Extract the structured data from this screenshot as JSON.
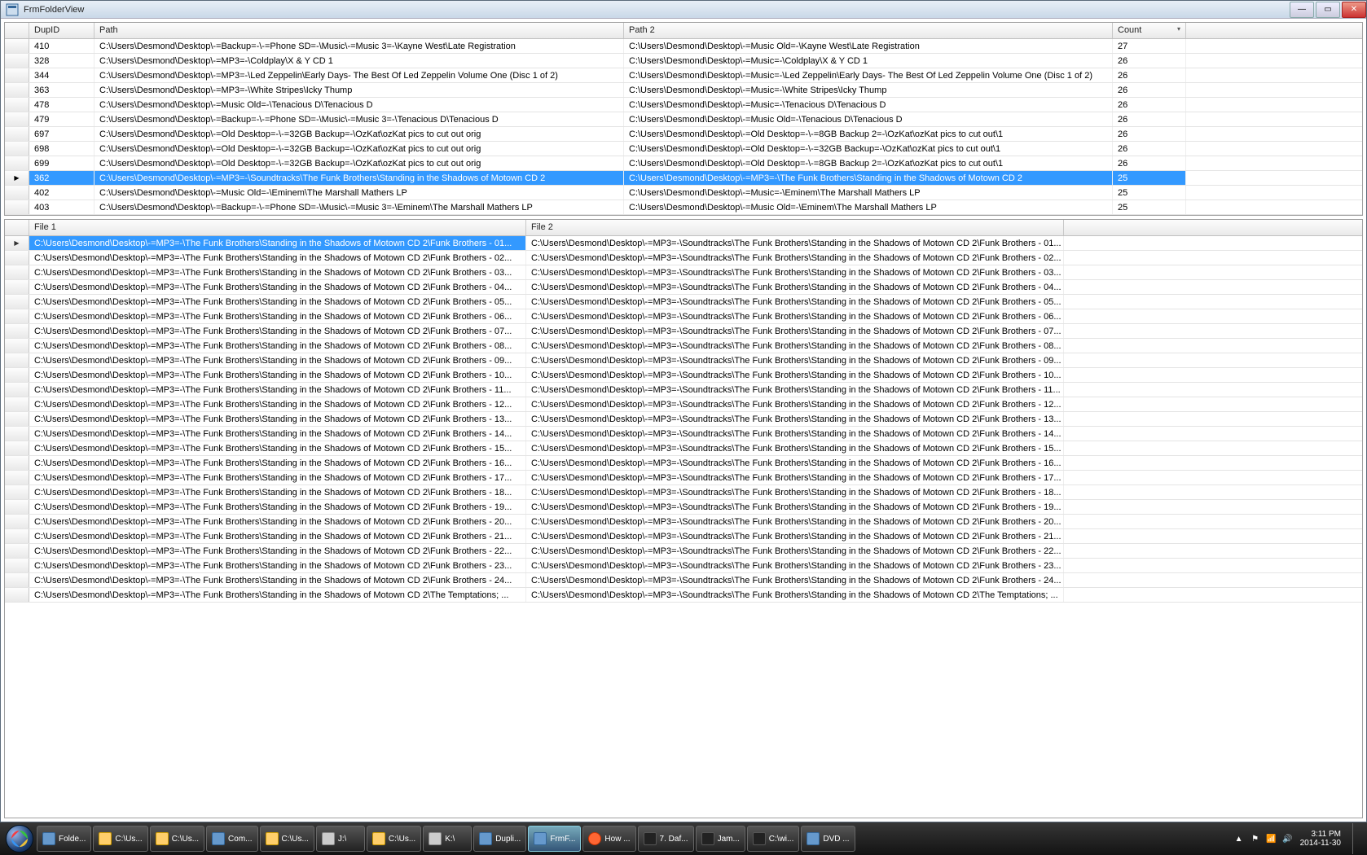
{
  "window": {
    "title": "FrmFolderView"
  },
  "topGrid": {
    "headers": {
      "dupid": "DupID",
      "path": "Path",
      "path2": "Path 2",
      "count": "Count"
    },
    "selectedIndex": 9,
    "rows": [
      {
        "dupid": "410",
        "path": "C:\\Users\\Desmond\\Desktop\\-=Backup=-\\-=Phone SD=-\\Music\\-=Music 3=-\\Kayne West\\Late Registration",
        "path2": "C:\\Users\\Desmond\\Desktop\\-=Music Old=-\\Kayne West\\Late Registration",
        "count": "27"
      },
      {
        "dupid": "328",
        "path": "C:\\Users\\Desmond\\Desktop\\-=MP3=-\\Coldplay\\X & Y CD 1",
        "path2": "C:\\Users\\Desmond\\Desktop\\-=Music=-\\Coldplay\\X & Y CD 1",
        "count": "26"
      },
      {
        "dupid": "344",
        "path": "C:\\Users\\Desmond\\Desktop\\-=MP3=-\\Led Zeppelin\\Early Days- The Best Of Led Zeppelin Volume One (Disc 1 of 2)",
        "path2": "C:\\Users\\Desmond\\Desktop\\-=Music=-\\Led Zeppelin\\Early Days- The Best Of Led Zeppelin Volume One (Disc 1 of 2)",
        "count": "26"
      },
      {
        "dupid": "363",
        "path": "C:\\Users\\Desmond\\Desktop\\-=MP3=-\\White Stripes\\Icky Thump",
        "path2": "C:\\Users\\Desmond\\Desktop\\-=Music=-\\White Stripes\\Icky Thump",
        "count": "26"
      },
      {
        "dupid": "478",
        "path": "C:\\Users\\Desmond\\Desktop\\-=Music Old=-\\Tenacious D\\Tenacious D",
        "path2": "C:\\Users\\Desmond\\Desktop\\-=Music=-\\Tenacious D\\Tenacious D",
        "count": "26"
      },
      {
        "dupid": "479",
        "path": "C:\\Users\\Desmond\\Desktop\\-=Backup=-\\-=Phone SD=-\\Music\\-=Music 3=-\\Tenacious D\\Tenacious D",
        "path2": "C:\\Users\\Desmond\\Desktop\\-=Music Old=-\\Tenacious D\\Tenacious D",
        "count": "26"
      },
      {
        "dupid": "697",
        "path": "C:\\Users\\Desmond\\Desktop\\-=Old Desktop=-\\-=32GB Backup=-\\OzKat\\ozKat pics to cut out orig",
        "path2": "C:\\Users\\Desmond\\Desktop\\-=Old Desktop=-\\-=8GB Backup 2=-\\OzKat\\ozKat pics to cut out\\1",
        "count": "26"
      },
      {
        "dupid": "698",
        "path": "C:\\Users\\Desmond\\Desktop\\-=Old Desktop=-\\-=32GB Backup=-\\OzKat\\ozKat pics to cut out orig",
        "path2": "C:\\Users\\Desmond\\Desktop\\-=Old Desktop=-\\-=32GB Backup=-\\OzKat\\ozKat pics to cut out\\1",
        "count": "26"
      },
      {
        "dupid": "699",
        "path": "C:\\Users\\Desmond\\Desktop\\-=Old Desktop=-\\-=32GB Backup=-\\OzKat\\ozKat pics to cut out orig",
        "path2": "C:\\Users\\Desmond\\Desktop\\-=Old Desktop=-\\-=8GB Backup 2=-\\OzKat\\ozKat pics to cut out\\1",
        "count": "26"
      },
      {
        "dupid": "362",
        "path": "C:\\Users\\Desmond\\Desktop\\-=MP3=-\\Soundtracks\\The Funk Brothers\\Standing in the Shadows of Motown CD 2",
        "path2": "C:\\Users\\Desmond\\Desktop\\-=MP3=-\\The Funk Brothers\\Standing in the Shadows of Motown CD 2",
        "count": "25"
      },
      {
        "dupid": "402",
        "path": "C:\\Users\\Desmond\\Desktop\\-=Music Old=-\\Eminem\\The Marshall Mathers LP",
        "path2": "C:\\Users\\Desmond\\Desktop\\-=Music=-\\Eminem\\The Marshall Mathers LP",
        "count": "25"
      },
      {
        "dupid": "403",
        "path": "C:\\Users\\Desmond\\Desktop\\-=Backup=-\\-=Phone SD=-\\Music\\-=Music 3=-\\Eminem\\The Marshall Mathers LP",
        "path2": "C:\\Users\\Desmond\\Desktop\\-=Music Old=-\\Eminem\\The Marshall Mathers LP",
        "count": "25"
      }
    ]
  },
  "botGrid": {
    "headers": {
      "file1": "File 1",
      "file2": "File 2"
    },
    "selectedIndex": 0,
    "basePath1": "C:\\Users\\Desmond\\Desktop\\-=MP3=-\\The Funk Brothers\\Standing in the Shadows of Motown CD 2\\",
    "basePath2": "C:\\Users\\Desmond\\Desktop\\-=MP3=-\\Soundtracks\\The Funk Brothers\\Standing in the Shadows of Motown CD 2\\",
    "tracks": [
      "Funk Brothers - 01...",
      "Funk Brothers - 02...",
      "Funk Brothers - 03...",
      "Funk Brothers - 04...",
      "Funk Brothers - 05...",
      "Funk Brothers - 06...",
      "Funk Brothers - 07...",
      "Funk Brothers - 08...",
      "Funk Brothers - 09...",
      "Funk Brothers - 10...",
      "Funk Brothers - 11...",
      "Funk Brothers - 12...",
      "Funk Brothers - 13...",
      "Funk Brothers - 14...",
      "Funk Brothers - 15...",
      "Funk Brothers - 16...",
      "Funk Brothers - 17...",
      "Funk Brothers - 18...",
      "Funk Brothers - 19...",
      "Funk Brothers - 20...",
      "Funk Brothers - 21...",
      "Funk Brothers - 22...",
      "Funk Brothers - 23...",
      "Funk Brothers - 24...",
      "The Temptations; ..."
    ]
  },
  "taskbar": {
    "items": [
      {
        "label": "Folde...",
        "icon": "app"
      },
      {
        "label": "C:\\Us...",
        "icon": "folder"
      },
      {
        "label": "C:\\Us...",
        "icon": "folder"
      },
      {
        "label": "Com...",
        "icon": "app"
      },
      {
        "label": "C:\\Us...",
        "icon": "folder"
      },
      {
        "label": "J:\\",
        "icon": "drive"
      },
      {
        "label": "C:\\Us...",
        "icon": "folder"
      },
      {
        "label": "K:\\",
        "icon": "drive"
      },
      {
        "label": "Dupli...",
        "icon": "app"
      },
      {
        "label": "FrmF...",
        "icon": "app",
        "active": true
      },
      {
        "label": "How ...",
        "icon": "ff"
      },
      {
        "label": "7. Daf...",
        "icon": "dark"
      },
      {
        "label": "Jam...",
        "icon": "dark"
      },
      {
        "label": "C:\\wi...",
        "icon": "dark"
      },
      {
        "label": "DVD ...",
        "icon": "app"
      }
    ],
    "tray": {
      "time": "3:11 PM",
      "date": "2014-11-30"
    }
  }
}
